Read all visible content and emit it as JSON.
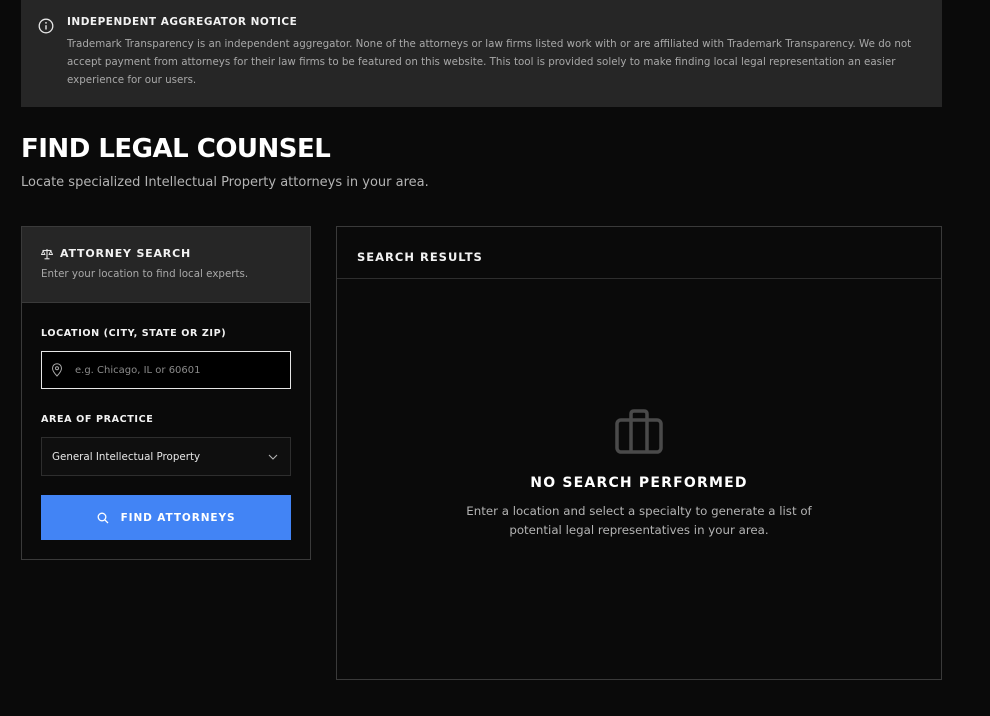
{
  "notice": {
    "title": "INDEPENDENT AGGREGATOR NOTICE",
    "text": "Trademark Transparency is an independent aggregator. None of the attorneys or law firms listed work with or are affiliated with Trademark Transparency. We do not accept payment from attorneys for their law firms to be featured on this website. This tool is provided solely to make finding local legal representation an easier experience for our users.",
    "icon": "info-icon"
  },
  "page": {
    "title": "FIND LEGAL COUNSEL",
    "subtitle": "Locate specialized Intellectual Property attorneys in your area."
  },
  "search": {
    "title": "ATTORNEY SEARCH",
    "subtitle": "Enter your location to find local experts.",
    "title_icon": "scales-icon",
    "location_label": "LOCATION (CITY, STATE OR ZIP)",
    "location_value": "",
    "location_placeholder": "e.g. Chicago, IL or 60601",
    "practice_label": "AREA OF PRACTICE",
    "practice_selected": "General Intellectual Property",
    "button_label": "FIND ATTORNEYS",
    "accent_color": "#4284f5"
  },
  "results": {
    "title": "SEARCH RESULTS",
    "empty_title": "NO SEARCH PERFORMED",
    "empty_text": "Enter a location and select a specialty to generate a list of potential legal representatives in your area.",
    "empty_icon": "briefcase-icon"
  }
}
